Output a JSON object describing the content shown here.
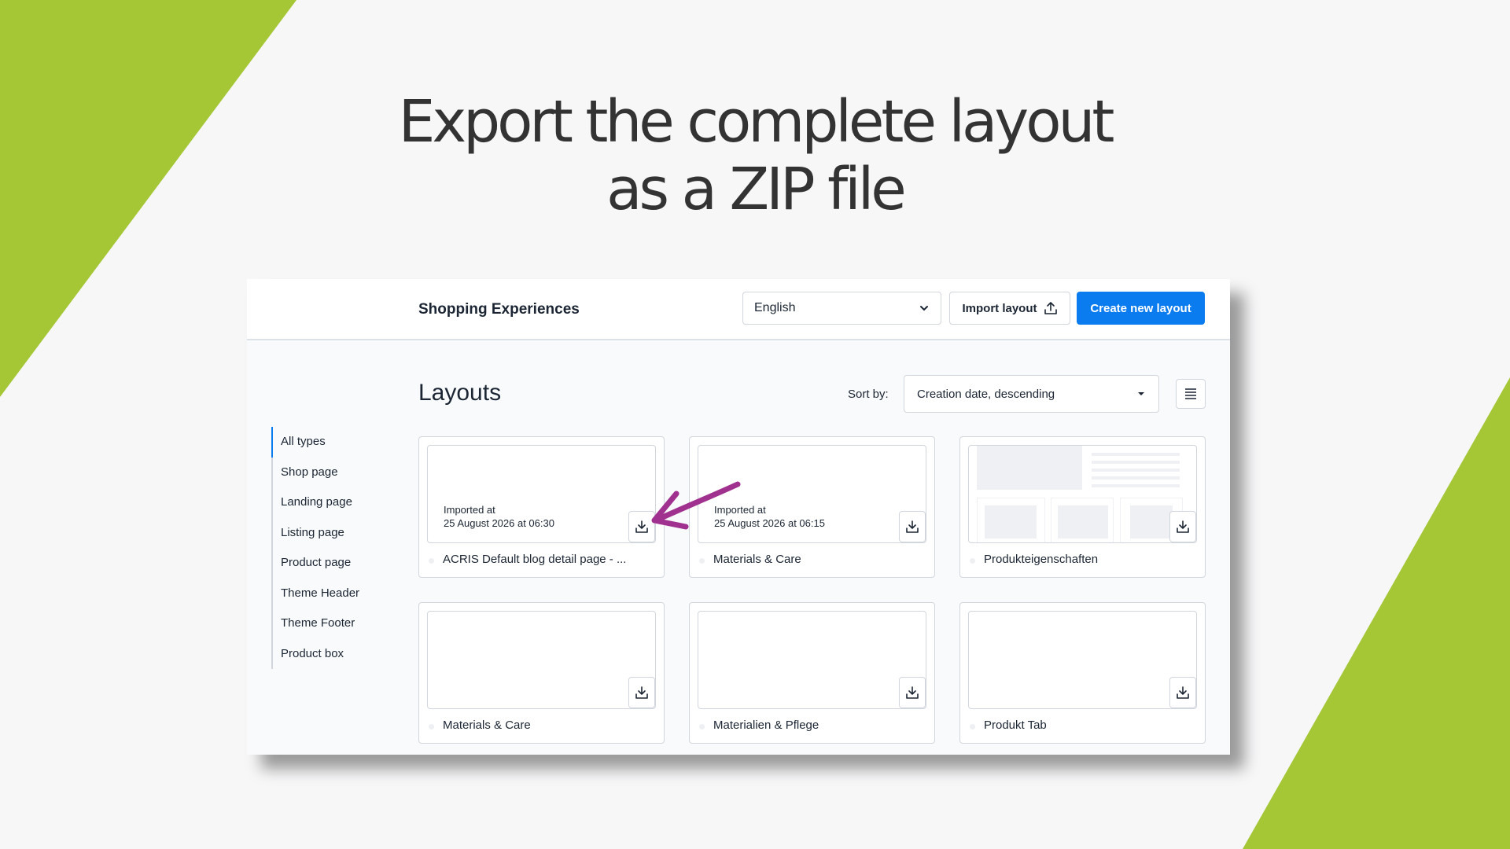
{
  "slide": {
    "headline_line1": "Export the complete layout",
    "headline_line2": "as a ZIP file",
    "accent_color": "#a5c736"
  },
  "header": {
    "title": "Shopping Experiences",
    "language_value": "English",
    "import_label": "Import layout",
    "create_label": "Create new layout",
    "primary_color": "#0b7bf0"
  },
  "main": {
    "title": "Layouts",
    "sort_label": "Sort by:",
    "sort_value": "Creation date, descending"
  },
  "sidebar": {
    "items": [
      {
        "label": "All types",
        "active": true
      },
      {
        "label": "Shop page"
      },
      {
        "label": "Landing page"
      },
      {
        "label": "Listing page"
      },
      {
        "label": "Product page"
      },
      {
        "label": "Theme Header"
      },
      {
        "label": "Theme Footer"
      },
      {
        "label": "Product box"
      }
    ]
  },
  "cards": [
    {
      "name": "ACRIS Default blog detail page - ...",
      "imported_label": "Imported at",
      "imported_date": "25 August 2026 at 06:30"
    },
    {
      "name": "Materials & Care",
      "imported_label": "Imported at",
      "imported_date": "25 August 2026 at 06:15"
    },
    {
      "name": "Produkteigenschaften"
    },
    {
      "name": "Materials & Care"
    },
    {
      "name": "Materialien & Pflege"
    },
    {
      "name": "Produkt Tab"
    }
  ],
  "icons": {
    "chevron": "chevron-down-icon",
    "upload": "upload-icon",
    "download": "download-icon",
    "list": "list-view-icon",
    "arrow": "annotation-arrow"
  }
}
